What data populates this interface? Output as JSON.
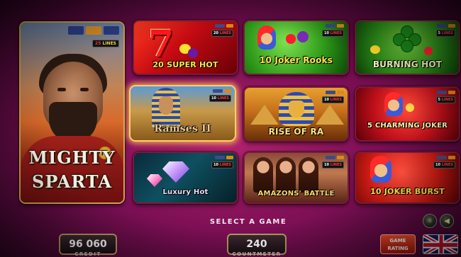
{
  "featured": {
    "title_line1": "MIGHTY",
    "title_line2": "SPARTA",
    "lines_count": "25",
    "lines_word": "LINES"
  },
  "games": [
    {
      "title": "20 SUPER HOT",
      "lines_count": "20",
      "lines_word": "LINES"
    },
    {
      "title": "10 Joker Rooks",
      "lines_count": "10",
      "lines_word": "LINES"
    },
    {
      "title": "BURNING HOT",
      "lines_count": "5",
      "lines_word": "LINES"
    },
    {
      "title": "Ramses II",
      "lines_count": "10",
      "lines_word": "LINES"
    },
    {
      "title": "RISE OF RA",
      "lines_count": "10",
      "lines_word": "LINES"
    },
    {
      "title": "5 CHARMING JOKER",
      "lines_count": "5",
      "lines_word": "LINES"
    },
    {
      "title": "Luxury Hot",
      "lines_count": "10",
      "lines_word": "LINES"
    },
    {
      "title": "AMAZONS' BATTLE",
      "lines_count": "10",
      "lines_word": "LINES"
    },
    {
      "title": "10 JOKER BURST",
      "lines_count": "10",
      "lines_word": "LINES"
    }
  ],
  "footer": {
    "select_prompt": "SELECT A GAME",
    "credit_value": "96 060",
    "credit_label": "CREDIT",
    "counter_value": "240",
    "counter_label": "COUNTMETER",
    "rating_line1": "GAME",
    "rating_line2": "RATING",
    "language_flag": "uk-flag-icon"
  },
  "colors": {
    "background": "#7d0f55",
    "frame_gold": "#d4a34a",
    "rating_button": "#c8200e"
  }
}
